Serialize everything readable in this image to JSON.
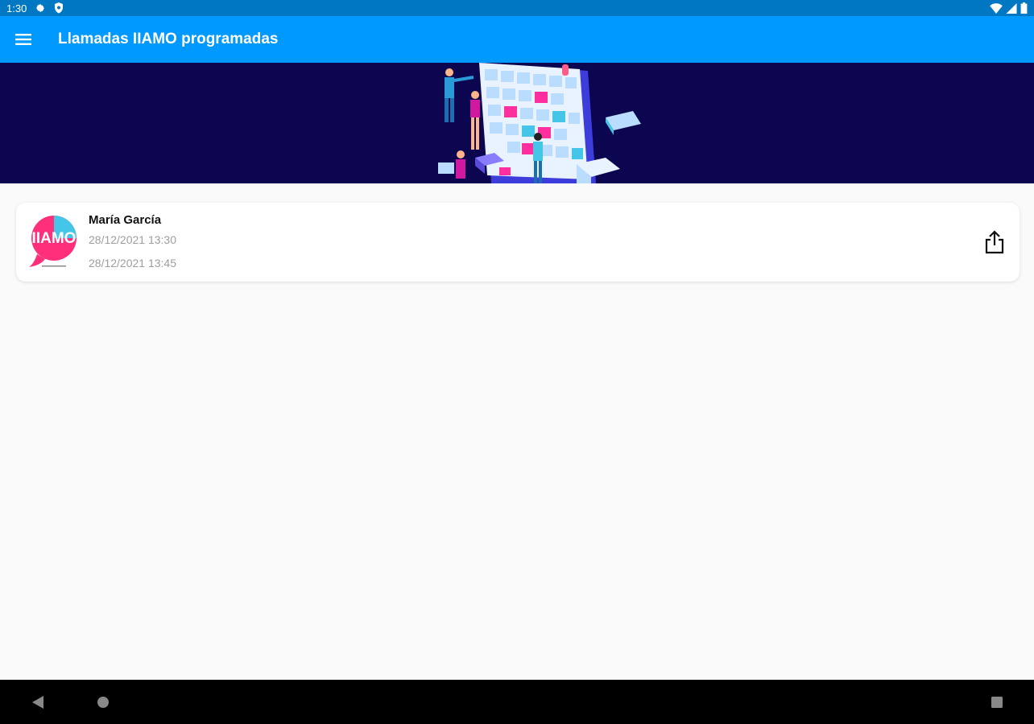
{
  "status_bar": {
    "time": "1:30",
    "icons": [
      "gear-icon",
      "shield-icon",
      "wifi-icon",
      "signal-icon",
      "battery-icon"
    ]
  },
  "app_bar": {
    "title": "Llamadas IIAMO programadas",
    "menu_icon": "hamburger-menu-icon",
    "color": "#0099ff"
  },
  "banner": {
    "background": "#0c0650"
  },
  "calls": [
    {
      "name": "María García",
      "start": "28/12/2021 13:30",
      "end": "28/12/2021 13:45",
      "logo_text": "IIAMO",
      "action_icon": "share-icon"
    }
  ],
  "nav_bar": {
    "icons": [
      "back-icon",
      "home-icon",
      "recents-icon"
    ]
  }
}
